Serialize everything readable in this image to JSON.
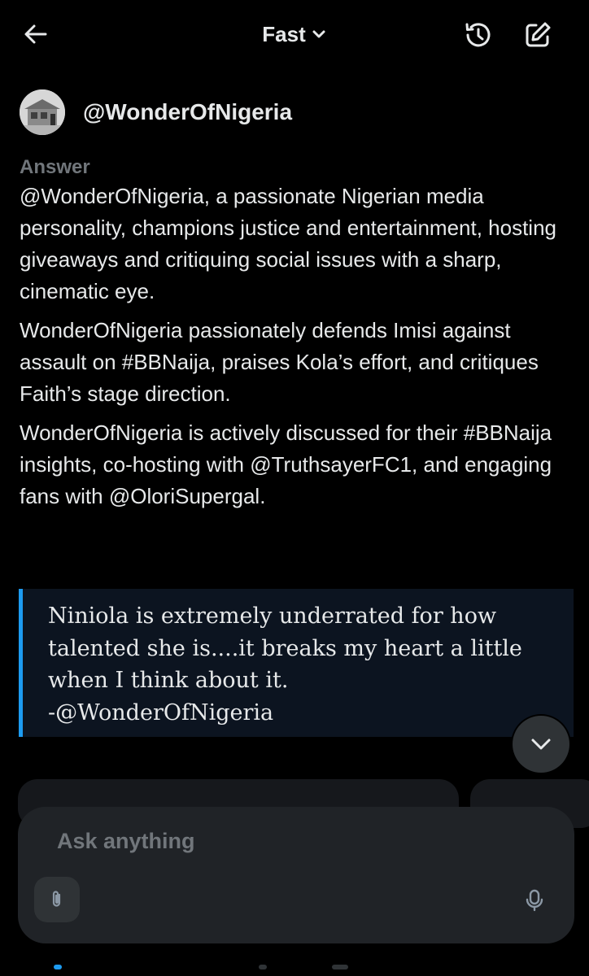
{
  "header": {
    "mode_label": "Fast",
    "icons": {
      "back": "arrow-left-icon",
      "mode_chevron": "chevron-down-icon",
      "history": "history-icon",
      "edit": "compose-icon"
    }
  },
  "profile": {
    "handle": "@WonderOfNigeria",
    "avatar": "avatar-photo"
  },
  "answer": {
    "label": "Answer",
    "paragraphs": [
      "@WonderOfNigeria, a passionate Nigerian media personality, champions justice and entertainment, hosting giveaways and critiquing social issues with a sharp, cinematic eye.",
      "WonderOfNigeria passionately defends Imisi against assault on #BBNaija, praises Kola’s effort, and critiques Faith’s stage direction.",
      "WonderOfNigeria is actively discussed for their #BBNaija insights, co-hosting with @TruthsayerFC1, and engaging fans with @OloriSupergal."
    ]
  },
  "quote": {
    "lines": [
      "Niniola is extremely underrated for how",
      "talented she is....it breaks my heart a little",
      "when I think about it.",
      "-@WonderOfNigeria"
    ],
    "accent_color": "#1d9bf0"
  },
  "composer": {
    "placeholder": "Ask anything",
    "icons": {
      "attach": "paperclip-icon",
      "mic": "microphone-icon"
    }
  },
  "colors": {
    "background": "#000000",
    "text": "#e7e9ea",
    "muted": "#71767b",
    "accent": "#1d9bf0",
    "composer": "#202327"
  }
}
